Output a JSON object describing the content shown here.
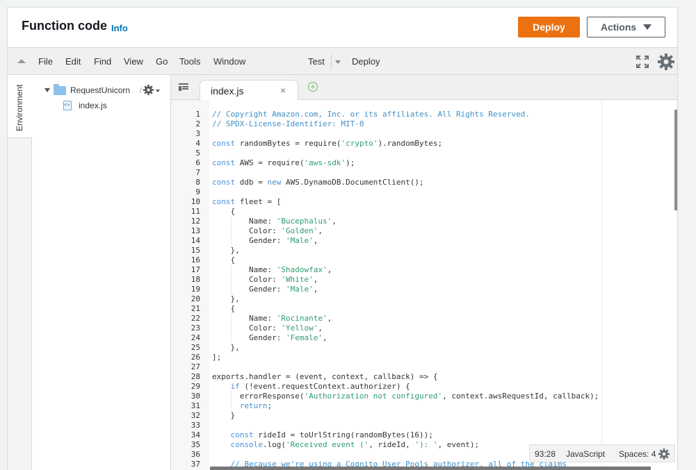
{
  "header": {
    "title": "Function code",
    "info_label": "Info",
    "deploy_label": "Deploy",
    "actions_label": "Actions"
  },
  "menubar": {
    "items": [
      "File",
      "Edit",
      "Find",
      "View",
      "Go",
      "Tools",
      "Window"
    ],
    "test_label": "Test",
    "deploy_label": "Deploy"
  },
  "sidebar": {
    "vertical_tab": "Environment",
    "folder": "RequestUnicorn",
    "folder_slash": "/",
    "file": "index.js"
  },
  "editor": {
    "tab_name": "index.js",
    "lines": [
      [
        {
          "t": "// Copyright Amazon.com, Inc. or its affiliates. All Rights Reserved.",
          "c": "c"
        }
      ],
      [
        {
          "t": "// SPDX-License-Identifier: MIT-0",
          "c": "c"
        }
      ],
      [],
      [
        {
          "t": "const",
          "c": "k"
        },
        {
          "t": " randomBytes = require("
        },
        {
          "t": "'crypto'",
          "c": "s"
        },
        {
          "t": ").randomBytes;"
        }
      ],
      [],
      [
        {
          "t": "const",
          "c": "k"
        },
        {
          "t": " AWS = require("
        },
        {
          "t": "'aws-sdk'",
          "c": "s"
        },
        {
          "t": ");"
        }
      ],
      [],
      [
        {
          "t": "const",
          "c": "k"
        },
        {
          "t": " ddb = "
        },
        {
          "t": "new",
          "c": "k"
        },
        {
          "t": " AWS.DynamoDB.DocumentClient();"
        }
      ],
      [],
      [
        {
          "t": "const",
          "c": "k"
        },
        {
          "t": " fleet = ["
        }
      ],
      [
        {
          "t": "    {"
        }
      ],
      [
        {
          "t": "        Name: "
        },
        {
          "t": "'Bucephalus'",
          "c": "s"
        },
        {
          "t": ","
        }
      ],
      [
        {
          "t": "        Color: "
        },
        {
          "t": "'Golden'",
          "c": "s"
        },
        {
          "t": ","
        }
      ],
      [
        {
          "t": "        Gender: "
        },
        {
          "t": "'Male'",
          "c": "s"
        },
        {
          "t": ","
        }
      ],
      [
        {
          "t": "    },"
        }
      ],
      [
        {
          "t": "    {"
        }
      ],
      [
        {
          "t": "        Name: "
        },
        {
          "t": "'Shadowfax'",
          "c": "s"
        },
        {
          "t": ","
        }
      ],
      [
        {
          "t": "        Color: "
        },
        {
          "t": "'White'",
          "c": "s"
        },
        {
          "t": ","
        }
      ],
      [
        {
          "t": "        Gender: "
        },
        {
          "t": "'Male'",
          "c": "s"
        },
        {
          "t": ","
        }
      ],
      [
        {
          "t": "    },"
        }
      ],
      [
        {
          "t": "    {"
        }
      ],
      [
        {
          "t": "        Name: "
        },
        {
          "t": "'Rocinante'",
          "c": "s"
        },
        {
          "t": ","
        }
      ],
      [
        {
          "t": "        Color: "
        },
        {
          "t": "'Yellow'",
          "c": "s"
        },
        {
          "t": ","
        }
      ],
      [
        {
          "t": "        Gender: "
        },
        {
          "t": "'Female'",
          "c": "s"
        },
        {
          "t": ","
        }
      ],
      [
        {
          "t": "    },"
        }
      ],
      [
        {
          "t": "];"
        }
      ],
      [],
      [
        {
          "t": "exports.handler = (event, context, callback) => {"
        }
      ],
      [
        {
          "t": "    "
        },
        {
          "t": "if",
          "c": "k"
        },
        {
          "t": " (!event.requestContext.authorizer) {"
        }
      ],
      [
        {
          "t": "      errorResponse("
        },
        {
          "t": "'Authorization not configured'",
          "c": "s"
        },
        {
          "t": ", context.awsRequestId, callback);"
        }
      ],
      [
        {
          "t": "      "
        },
        {
          "t": "return",
          "c": "k"
        },
        {
          "t": ";"
        }
      ],
      [
        {
          "t": "    }"
        }
      ],
      [],
      [
        {
          "t": "    "
        },
        {
          "t": "const",
          "c": "k"
        },
        {
          "t": " rideId = toUrlString(randomBytes(16));"
        }
      ],
      [
        {
          "t": "    "
        },
        {
          "t": "console",
          "c": "k"
        },
        {
          "t": ".log("
        },
        {
          "t": "'Received event ('",
          "c": "s"
        },
        {
          "t": ", rideId, "
        },
        {
          "t": "'): '",
          "c": "s"
        },
        {
          "t": ", event);"
        }
      ],
      [],
      [
        {
          "t": "    // Because we're using a Cognito User Pools authorizer, all of the claims",
          "c": "c"
        }
      ]
    ]
  },
  "status": {
    "position": "93:28",
    "language": "JavaScript",
    "spaces": "Spaces: 4"
  }
}
